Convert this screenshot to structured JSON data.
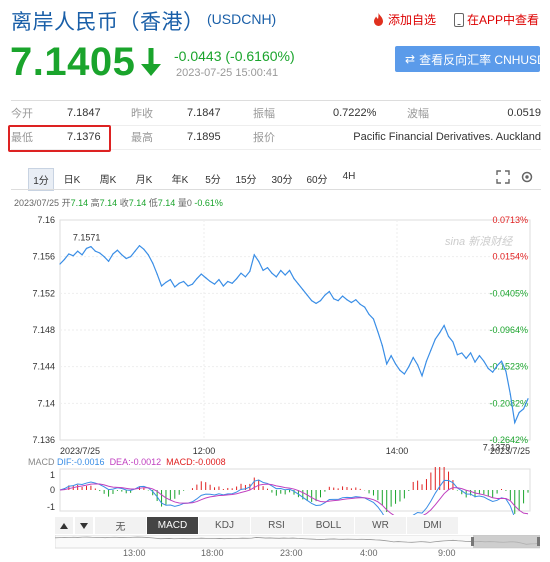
{
  "header": {
    "title": "离岸人民币（香港）",
    "code": "(USDCNH)",
    "add_fav": "添加自选",
    "app_view": "在APP中查看",
    "price": "7.1405",
    "change": "-0.0443 (-0.6160%)",
    "timestamp": "2023-07-25 15:00:41",
    "reverse_btn": "查看反向汇率 CNHUSD",
    "colors": {
      "down": "#1aa42c",
      "up": "#e02020",
      "brand": "#1a5fa8"
    }
  },
  "stats": {
    "open_label": "今开",
    "open": "7.1847",
    "prev_label": "昨收",
    "prev": "7.1847",
    "amp_label": "振幅",
    "amp": "0.7222%",
    "wave_label": "波幅",
    "wave": "0.0519",
    "low_label": "最低",
    "low": "7.1376",
    "high_label": "最高",
    "high": "7.1895",
    "quote_label": "报价",
    "quote": "Pacific Financial Derivatives. Auckland"
  },
  "tabs": [
    "1分",
    "日K",
    "周K",
    "月K",
    "年K",
    "5分",
    "15分",
    "30分",
    "60分",
    "4H"
  ],
  "active_tab": "1分",
  "chart_info": {
    "date": "2023/07/25",
    "open_l": "开",
    "open_v": "7.14",
    "high_l": "高",
    "high_v": "7.14",
    "close_l": "收",
    "close_v": "7.14",
    "low_l": "低",
    "low_v": "7.14",
    "vol_l": "量",
    "vol_v": "0",
    "pct": "-0.61%"
  },
  "chart_data": {
    "type": "line",
    "x_labels": [
      "2023/7/25",
      "12:00",
      "14:00",
      "2023/7/25"
    ],
    "y_ticks": [
      "7.16",
      "7.156",
      "7.152",
      "7.148",
      "7.144",
      "7.14",
      "7.136"
    ],
    "right_ticks": [
      "0.0713%",
      "0.0154%",
      "-0.0405%",
      "-0.0964%",
      "-0.1523%",
      "-0.2082%",
      "-0.2642%"
    ],
    "ylim": [
      7.136,
      7.16
    ],
    "annotations": [
      {
        "label": "7.1571",
        "value": 7.1571
      },
      {
        "label": "7.1379",
        "value": 7.1379
      }
    ],
    "watermark": "sina 新浪财经",
    "series": [
      {
        "values": [
          7.1552,
          7.1557,
          7.1563,
          7.1561,
          7.1566,
          7.1562,
          7.1569,
          7.1571,
          7.1566,
          7.1564,
          7.156,
          7.1555,
          7.1563,
          7.1567,
          7.1562,
          7.1558,
          7.156,
          7.1566,
          7.1572,
          7.1568,
          7.1562,
          7.1553,
          7.1541,
          7.1528,
          7.1532,
          7.1535,
          7.1527,
          7.1531,
          7.1533,
          7.1528,
          7.153,
          7.1536,
          7.1541,
          7.1537,
          7.1533,
          7.153,
          7.1535,
          7.1528,
          7.1533,
          7.1531,
          7.1536,
          7.1542,
          7.1538,
          7.1544,
          7.1562,
          7.1555,
          7.1545,
          7.1548,
          7.1542,
          7.1538,
          7.1545,
          7.154,
          7.1545,
          7.1536,
          7.153,
          7.1524,
          7.1518,
          7.1512,
          7.1509,
          7.1512,
          7.1518,
          7.1522,
          7.1514,
          7.1512,
          7.1517,
          7.1513,
          7.151,
          7.1513,
          7.1508,
          7.1505,
          7.1497,
          7.1492,
          7.1478,
          7.1463,
          7.1443,
          7.1452,
          7.1443,
          7.1436,
          7.1432,
          7.144,
          7.145,
          7.1442,
          7.143,
          7.1446,
          7.1458,
          7.147,
          7.1477,
          7.1485,
          7.1473,
          7.1467,
          7.1453,
          7.1455,
          7.1449,
          7.1455,
          7.1445,
          7.1452,
          7.1446,
          7.1438,
          7.1434,
          7.1441,
          7.1446,
          7.1435,
          7.141,
          7.1379,
          7.139,
          7.1394,
          7.1405
        ]
      }
    ]
  },
  "macd": {
    "label": "MACD",
    "dif_l": "DIF:",
    "dif_v": "-0.0016",
    "dea_l": "DEA:",
    "dea_v": "-0.0012",
    "macd_l": "MACD:",
    "macd_v": "-0.0008",
    "y_ticks": [
      "1",
      "0",
      "-1"
    ]
  },
  "bottom_tabs": [
    "无",
    "MACD",
    "KDJ",
    "RSI",
    "BOLL",
    "WR",
    "DMI"
  ],
  "active_bottom_tab": "MACD",
  "timeline_labels": [
    "13:00",
    "18:00",
    "23:00",
    "4:00",
    "9:00"
  ]
}
